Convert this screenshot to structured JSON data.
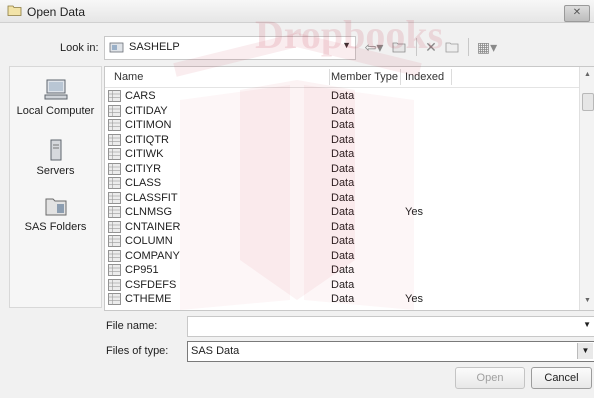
{
  "window": {
    "title": "Open Data",
    "close_label": "✕"
  },
  "lookin": {
    "label": "Look in:",
    "value": "SASHELP"
  },
  "toolbar": {
    "back_icon": "back-arrow-icon",
    "up_icon": "up-folder-icon",
    "delete_icon": "delete-icon",
    "newfolder_icon": "new-folder-icon",
    "views_icon": "views-menu-icon"
  },
  "places": [
    {
      "label": "Local Computer",
      "icon": "computer-icon"
    },
    {
      "label": "Servers",
      "icon": "server-icon"
    },
    {
      "label": "SAS Folders",
      "icon": "folder-icon"
    }
  ],
  "columns": {
    "name": "Name",
    "type": "Member Type",
    "indexed": "Indexed"
  },
  "files": [
    {
      "name": "CARS",
      "type": "Data",
      "indexed": ""
    },
    {
      "name": "CITIDAY",
      "type": "Data",
      "indexed": ""
    },
    {
      "name": "CITIMON",
      "type": "Data",
      "indexed": ""
    },
    {
      "name": "CITIQTR",
      "type": "Data",
      "indexed": ""
    },
    {
      "name": "CITIWK",
      "type": "Data",
      "indexed": ""
    },
    {
      "name": "CITIYR",
      "type": "Data",
      "indexed": ""
    },
    {
      "name": "CLASS",
      "type": "Data",
      "indexed": ""
    },
    {
      "name": "CLASSFIT",
      "type": "Data",
      "indexed": ""
    },
    {
      "name": "CLNMSG",
      "type": "Data",
      "indexed": "Yes"
    },
    {
      "name": "CNTAINER",
      "type": "Data",
      "indexed": ""
    },
    {
      "name": "COLUMN",
      "type": "Data",
      "indexed": ""
    },
    {
      "name": "COMPANY",
      "type": "Data",
      "indexed": ""
    },
    {
      "name": "CP951",
      "type": "Data",
      "indexed": ""
    },
    {
      "name": "CSFDEFS",
      "type": "Data",
      "indexed": ""
    },
    {
      "name": "CTHEME",
      "type": "Data",
      "indexed": "Yes"
    }
  ],
  "filename": {
    "label": "File name:",
    "value": ""
  },
  "filetype": {
    "label": "Files of type:",
    "value": "SAS Data"
  },
  "buttons": {
    "open": "Open",
    "cancel": "Cancel"
  },
  "watermark": {
    "text": "Dropbooks",
    "color": "#c01a30"
  }
}
